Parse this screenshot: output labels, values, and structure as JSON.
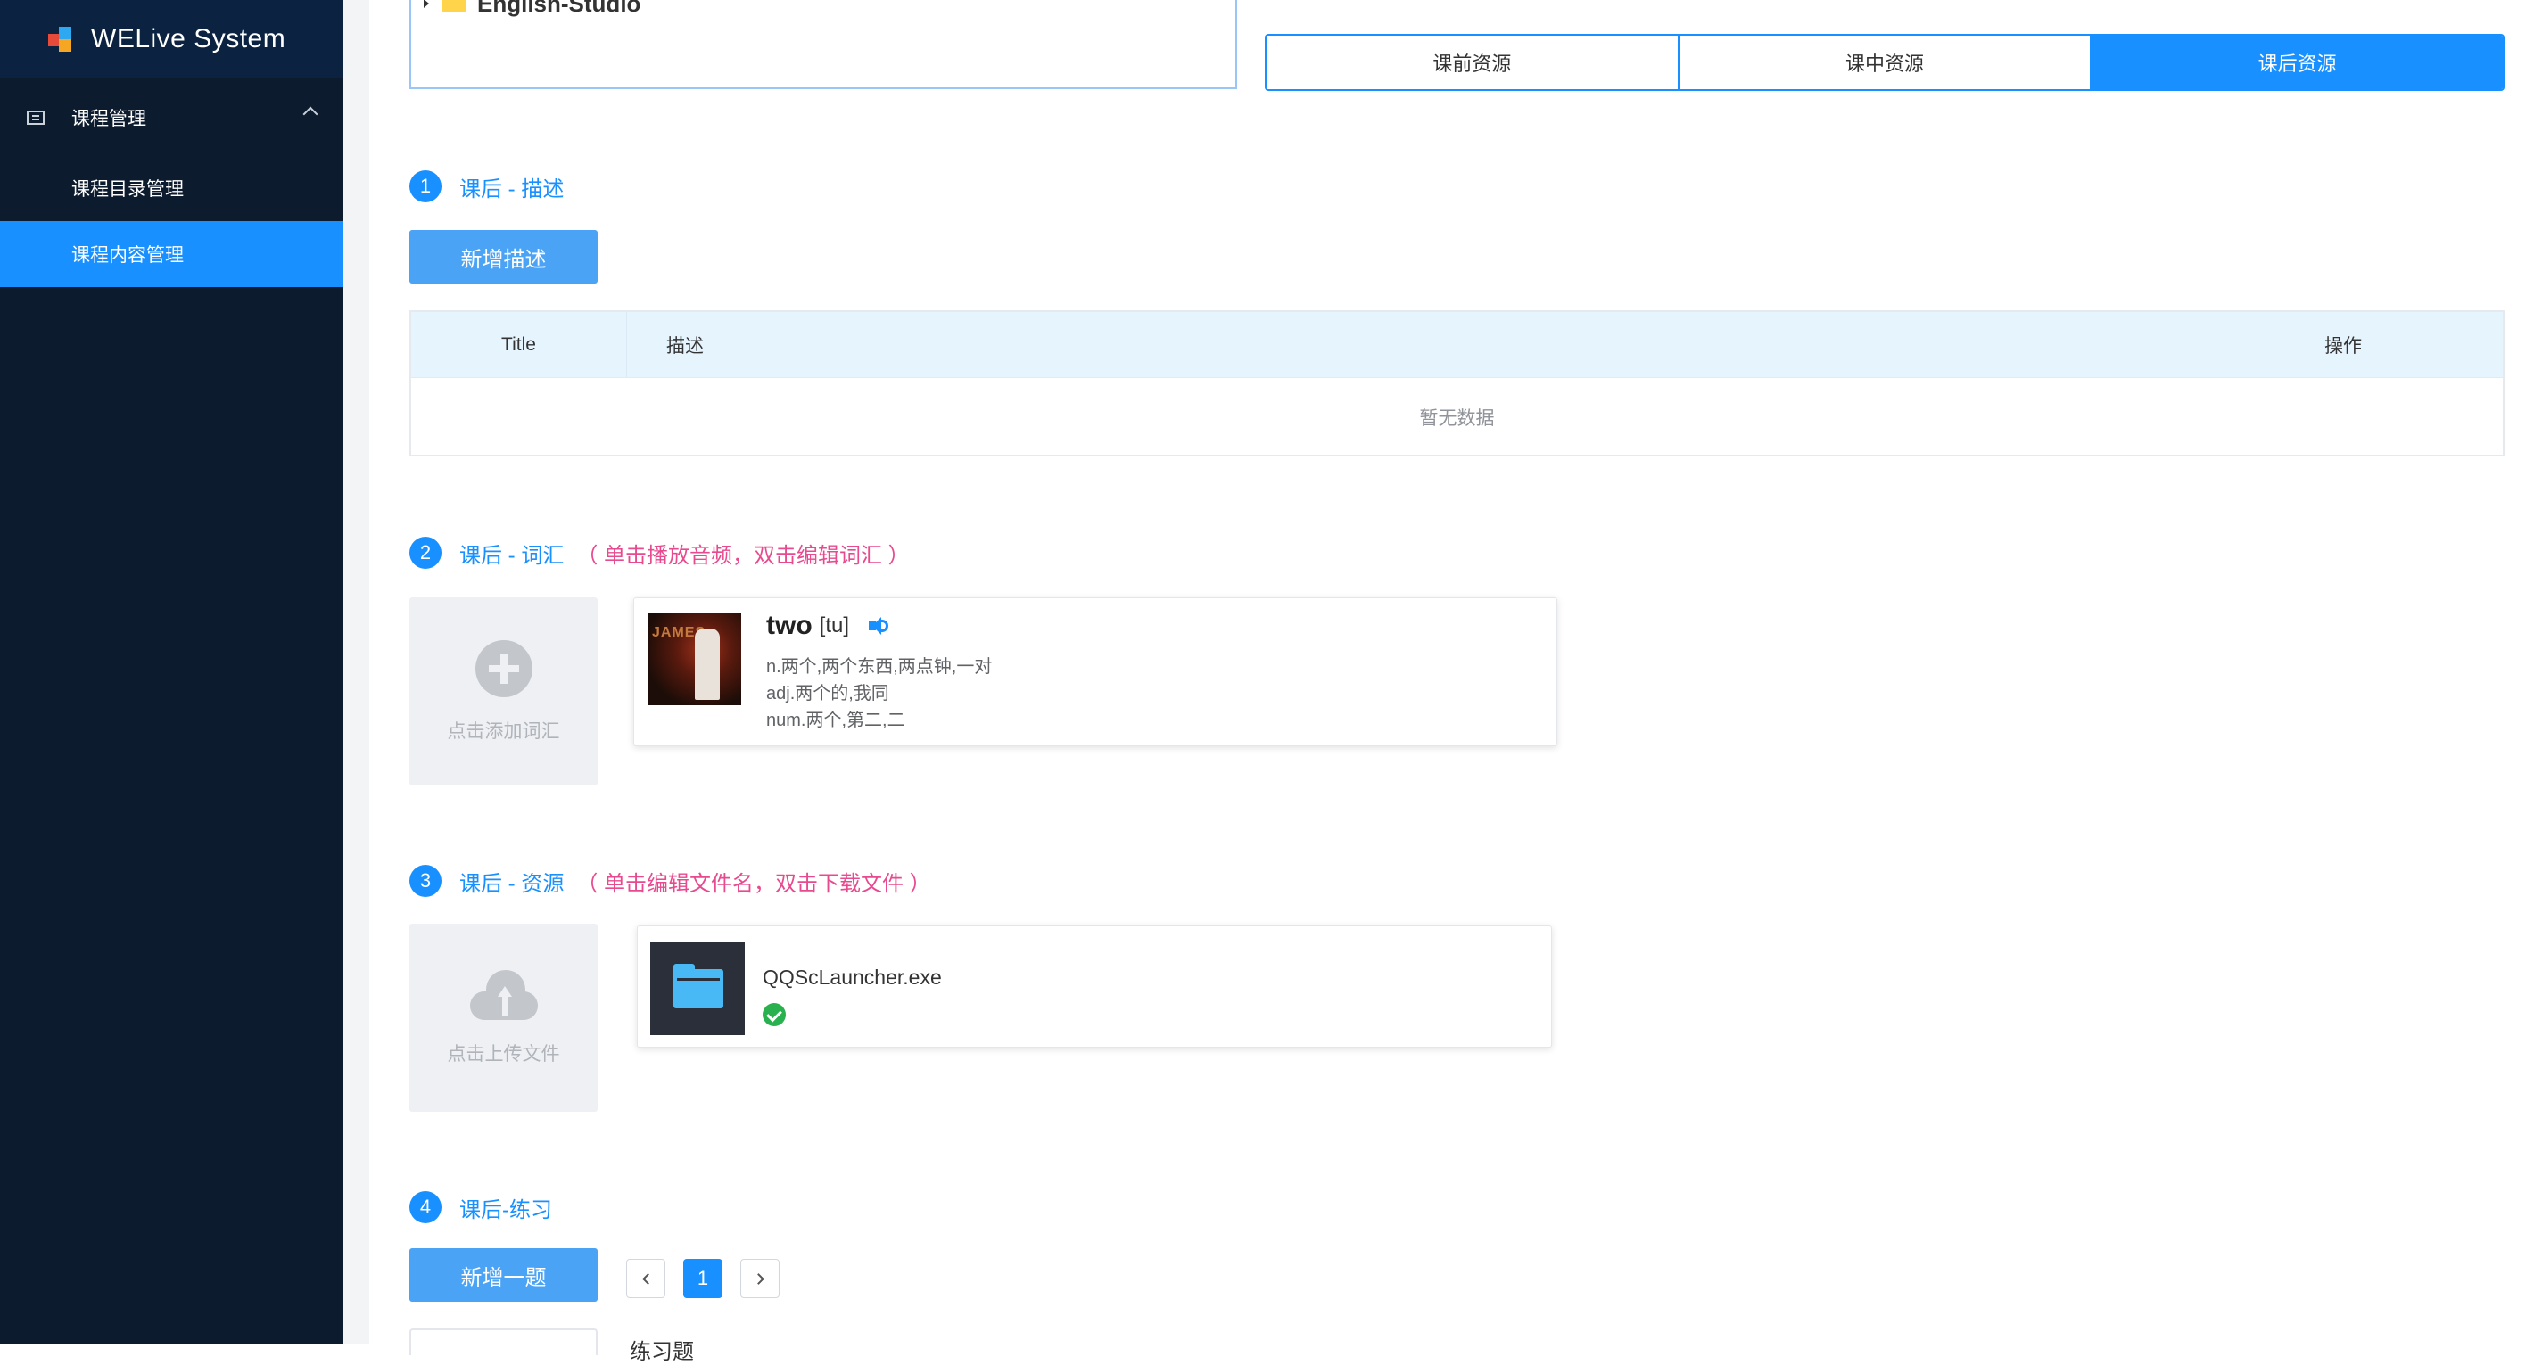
{
  "app": {
    "title": "WELive System"
  },
  "sidebar": {
    "group_label": "课程管理",
    "items": [
      {
        "label": "课程目录管理"
      },
      {
        "label": "课程内容管理"
      }
    ]
  },
  "tree": {
    "folder_name": "English-Studio"
  },
  "tabs": [
    {
      "label": "课前资源"
    },
    {
      "label": "课中资源"
    },
    {
      "label": "课后资源"
    }
  ],
  "sections": {
    "desc": {
      "num": "1",
      "title": "课后 - 描述",
      "add_button": "新增描述"
    },
    "vocab": {
      "num": "2",
      "title": "课后 - 词汇",
      "hint": "（ 单击播放音频，双击编辑词汇 ）",
      "add_label": "点击添加词汇"
    },
    "resource": {
      "num": "3",
      "title": "课后 - 资源",
      "hint": "（ 单击编辑文件名，双击下载文件 ）",
      "upload_label": "点击上传文件"
    },
    "exercise": {
      "num": "4",
      "title": "课后-练习",
      "add_button": "新增一题"
    }
  },
  "desc_table": {
    "columns": [
      "Title",
      "描述",
      "操作"
    ],
    "empty_text": "暂无数据"
  },
  "vocab_card": {
    "word": "two",
    "phonetic": "[tu]",
    "image_text": "JAMES",
    "meanings": [
      "n.两个,两个东西,两点钟,一对",
      "adj.两个的,我同",
      "num.两个,第二,二"
    ]
  },
  "file_card": {
    "name": "QQScLauncher.exe"
  },
  "pager": {
    "current": "1"
  },
  "bottom": {
    "text": "练习题"
  },
  "colors": {
    "primary": "#1890ff",
    "sidebar": "#0d1b2e",
    "hint": "#e84a8f",
    "success": "#29b14f"
  }
}
